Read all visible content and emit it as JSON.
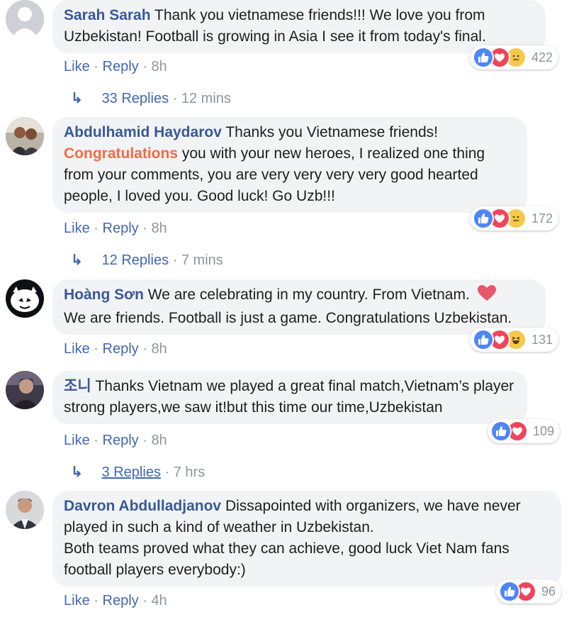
{
  "comments": [
    {
      "author": "Sarah Sarah",
      "mention": "",
      "text": "Thank you vietnamese friends!!! We love you from Uzbekistan! Football is growing in Asia I see it from today's final.",
      "like": "Like",
      "reply": "Reply",
      "time": "8h",
      "reaction_count": "422",
      "reactions": [
        "like",
        "love",
        "sad"
      ],
      "replies_label": "33 Replies",
      "replies_time": "12 mins"
    },
    {
      "author": "Abdulhamid Haydarov",
      "mention": "Congratulations",
      "text_before": "Thanks you Vietnamese friends!",
      "text_after": "you with your new heroes, I realized one thing from your comments, you are very very very very good hearted people, I loved you. Good luck! Go Uzb!!!",
      "like": "Like",
      "reply": "Reply",
      "time": "8h",
      "reaction_count": "172",
      "reactions": [
        "like",
        "love",
        "sad"
      ],
      "replies_label": "12 Replies",
      "replies_time": "7 mins"
    },
    {
      "author": "Hoàng Sơn",
      "text": "We are celebrating in my country. From Vietnam.",
      "text_line2": "We are friends. Football is just a game. Congratulations Uzbekistan.",
      "like": "Like",
      "reply": "Reply",
      "time": "8h",
      "reaction_count": "131",
      "reactions": [
        "like",
        "love",
        "haha"
      ]
    },
    {
      "author": "조니",
      "text": "Thanks Vietnam we played a great final match,Vietnam’s player strong players,we saw it!but this time our time,Uzbekistan",
      "like": "Like",
      "reply": "Reply",
      "time": "8h",
      "reaction_count": "109",
      "reactions": [
        "like",
        "love"
      ],
      "replies_label": "3 Replies",
      "replies_time": "7 hrs"
    },
    {
      "author": "Davron Abdulladjanov",
      "text": "Dissapointed with organizers, we have never played in such a kind of weather in Uzbekistan.",
      "text_line2": "Both teams proved what they can achieve, good luck Viet Nam fans football players everybody:)",
      "like": "Like",
      "reply": "Reply",
      "time": "4h",
      "reaction_count": "96",
      "reactions": [
        "like",
        "love"
      ]
    }
  ],
  "separator": "·",
  "colors": {
    "author": "#385898",
    "link": "#4267b2",
    "meta": "#90949c",
    "bubble": "#f2f3f5",
    "mention": "#f26b43",
    "like": "#4e86f6",
    "love": "#f0445b",
    "emoji": "#f7c94a"
  }
}
